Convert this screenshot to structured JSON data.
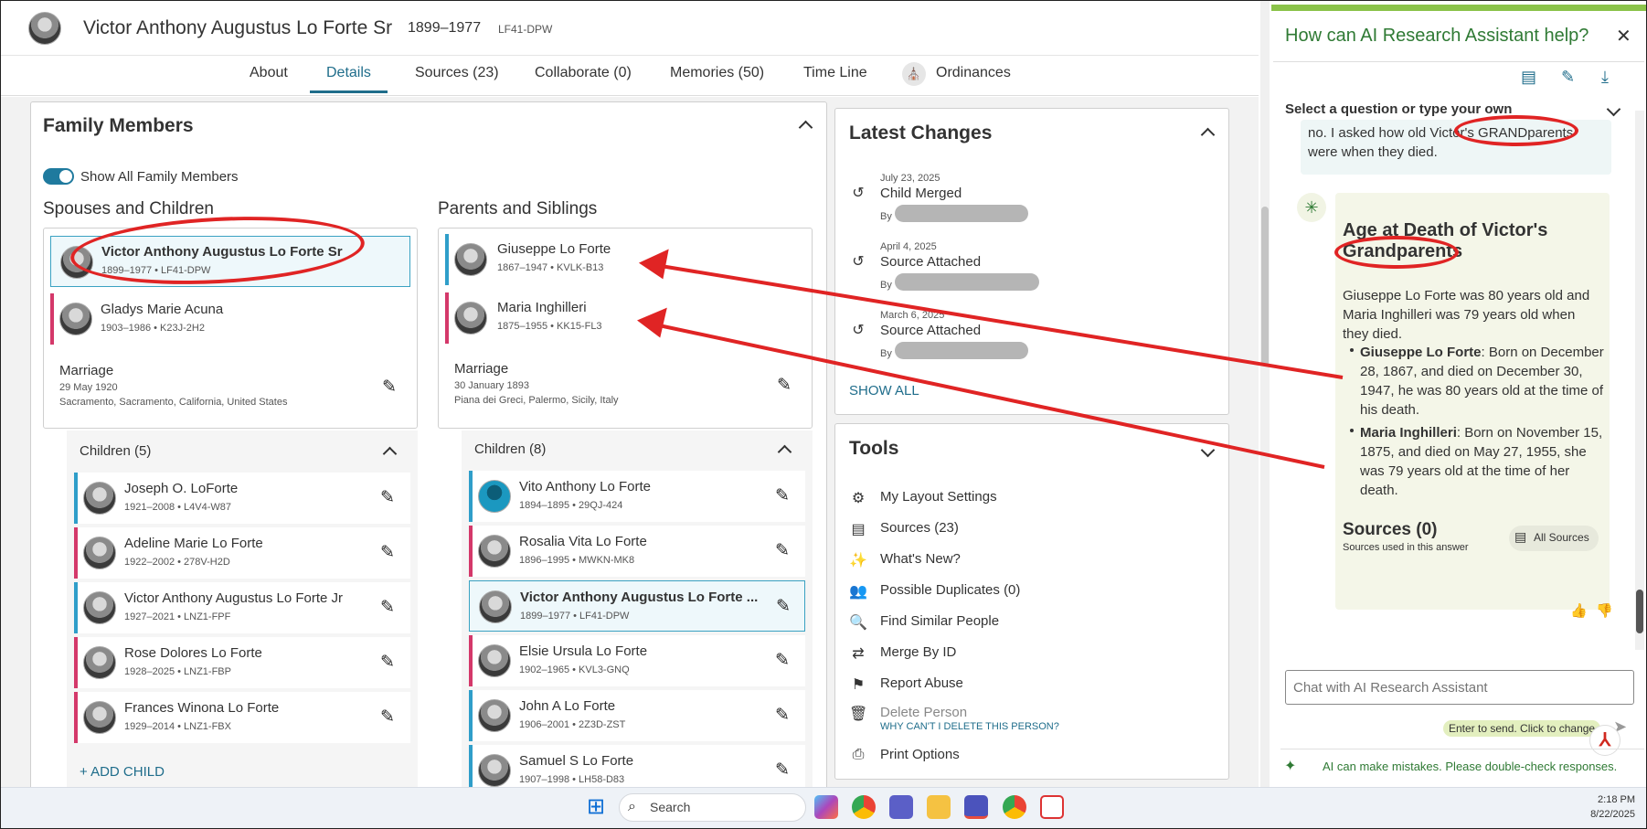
{
  "header": {
    "name": "Victor Anthony Augustus Lo Forte Sr",
    "dates": "1899–1977",
    "pid": "LF41-DPW"
  },
  "tabs": [
    {
      "label": "About"
    },
    {
      "label": "Details"
    },
    {
      "label": "Sources (23)"
    },
    {
      "label": "Collaborate (0)"
    },
    {
      "label": "Memories (50)"
    },
    {
      "label": "Time Line"
    },
    {
      "label": "Ordinances"
    }
  ],
  "family": {
    "title": "Family Members",
    "toggle_label": "Show All Family Members",
    "spouses_title": "Spouses and Children",
    "parents_title": "Parents and Siblings",
    "self": {
      "name": "Victor Anthony Augustus Lo Forte Sr",
      "info": "1899–1977 • LF41-DPW"
    },
    "spouse": {
      "name": "Gladys Marie Acuna",
      "info": "1903–1986 • K23J-2H2"
    },
    "marriage1": {
      "label": "Marriage",
      "date": "29 May 1920",
      "place": "Sacramento, Sacramento, California, United States"
    },
    "father": {
      "name": "Giuseppe Lo Forte",
      "info": "1867–1947 • KVLK-B13"
    },
    "mother": {
      "name": "Maria Inghilleri",
      "info": "1875–1955 • KK15-FL3"
    },
    "marriage2": {
      "label": "Marriage",
      "date": "30 January 1893",
      "place": "Piana dei Greci, Palermo, Sicily, Italy"
    },
    "children_title": "Children (5)",
    "children": [
      {
        "name": "Joseph O. LoForte",
        "info": "1921–2008 • L4V4-W87"
      },
      {
        "name": "Adeline Marie Lo Forte",
        "info": "1922–2002 • 278V-H2D"
      },
      {
        "name": "Victor Anthony Augustus Lo Forte Jr",
        "info": "1927–2021 • LNZ1-FPF"
      },
      {
        "name": "Rose Dolores Lo Forte",
        "info": "1928–2025 • LNZ1-FBP"
      },
      {
        "name": "Frances Winona Lo Forte",
        "info": "1929–2014 • LNZ1-FBX"
      }
    ],
    "add_child": "+ ADD CHILD",
    "siblings_title": "Children (8)",
    "siblings": [
      {
        "name": "Vito Anthony Lo Forte",
        "info": "1894–1895 • 29QJ-424"
      },
      {
        "name": "Rosalia Vita Lo Forte",
        "info": "1896–1995 • MWKN-MK8"
      },
      {
        "name": "Victor Anthony Augustus Lo Forte ...",
        "info": "1899–1977 • LF41-DPW"
      },
      {
        "name": "Elsie Ursula Lo Forte",
        "info": "1902–1965 • KVL3-GNQ"
      },
      {
        "name": "John A Lo Forte",
        "info": "1906–2001 • 2Z3D-ZST"
      },
      {
        "name": "Samuel S Lo Forte",
        "info": "1907–1998 • LH58-D83"
      }
    ]
  },
  "latest": {
    "title": "Latest Changes",
    "items": [
      {
        "date": "July 23, 2025",
        "action": "Child Merged",
        "by": "By"
      },
      {
        "date": "April 4, 2025",
        "action": "Source Attached",
        "by": "By"
      },
      {
        "date": "March 6, 2025",
        "action": "Source Attached",
        "by": "By"
      }
    ],
    "show_all": "SHOW ALL"
  },
  "tools": {
    "title": "Tools",
    "items": [
      "My Layout Settings",
      "Sources (23)",
      "What's New?",
      "Possible Duplicates (0)",
      "Find Similar People",
      "Merge By ID",
      "Report Abuse",
      "Delete Person",
      "Print Options"
    ],
    "delete_why": "WHY CAN'T I DELETE THIS PERSON?"
  },
  "ai": {
    "title": "How can AI Research Assistant help?",
    "select_label": "Select a question or type your own",
    "user_msg": "no. I asked how old Victor's GRANDparents were when they died.",
    "answer_title": "Age at Death of Victor's Grandparents",
    "answer_intro": "Giuseppe Lo Forte was 80 years old and Maria Inghilleri was 79 years old when they died.",
    "b1_name": "Giuseppe Lo Forte",
    "b1_text": ": Born on December 28, 1867, and died on December 30, 1947, he was 80 years old at the time of his death.",
    "b2_name": "Maria Inghilleri",
    "b2_text": ": Born on November 15, 1875, and died on May 27, 1955, she was 79 years old at the time of her death.",
    "sources_title": "Sources (0)",
    "sources_sub": "Sources used in this answer",
    "all_sources": "All Sources",
    "chat_placeholder": "Chat with AI Research Assistant",
    "enter_hint": "Enter to send. Click to change",
    "disclaimer": "AI can make mistakes. Please double-check responses."
  },
  "taskbar": {
    "search": "Search",
    "time": "2:18 PM",
    "date": "8/22/2025"
  },
  "colors": {
    "accent": "#1f6d8b",
    "male": "#2f9ec9",
    "female": "#d4386a",
    "ai_green": "#2f7a34",
    "annotation": "#e02424"
  }
}
